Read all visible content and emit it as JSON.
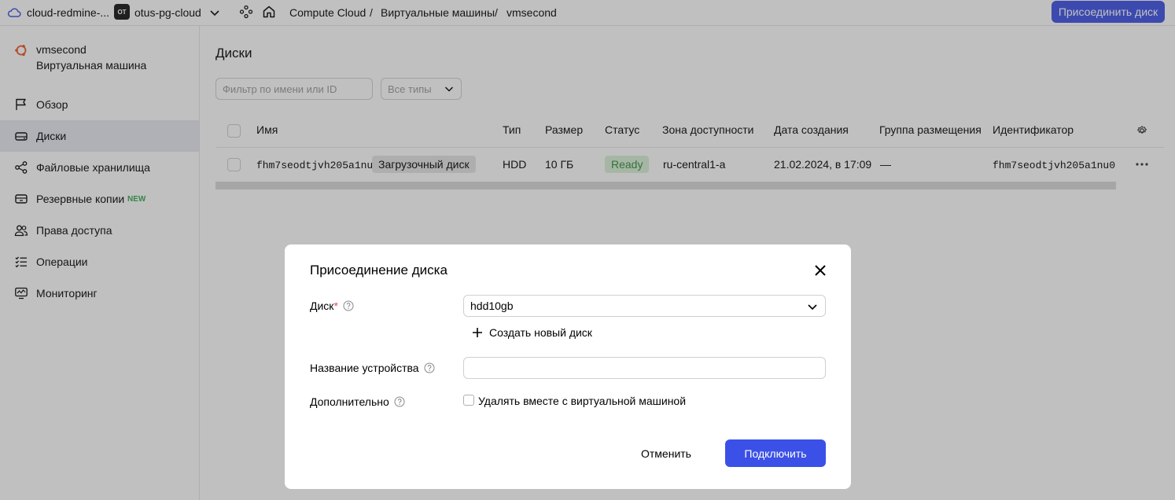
{
  "topbar": {
    "cloud_name": "cloud-redmine-...",
    "folder_badge": "OT",
    "folder_name": "otus-pg-cloud",
    "breadcrumbs": [
      "Compute Cloud",
      "Виртуальные машины",
      "vmsecond"
    ],
    "separator": "/",
    "attach_button": "Присоединить диск"
  },
  "sidebar": {
    "vm_name": "vmsecond",
    "vm_type": "Виртуальная машина",
    "items": [
      {
        "label": "Обзор",
        "icon": "flag-icon"
      },
      {
        "label": "Диски",
        "icon": "disk-icon",
        "active": true
      },
      {
        "label": "Файловые хранилища",
        "icon": "file-storage-icon"
      },
      {
        "label": "Резервные копии",
        "icon": "backup-icon",
        "badge": "NEW"
      },
      {
        "label": "Права доступа",
        "icon": "users-icon"
      },
      {
        "label": "Операции",
        "icon": "operations-icon"
      },
      {
        "label": "Мониторинг",
        "icon": "monitoring-icon"
      }
    ]
  },
  "main": {
    "title": "Диски",
    "filter_placeholder": "Фильтр по имени или ID",
    "type_select": "Все типы",
    "columns": [
      "Имя",
      "Тип",
      "Размер",
      "Статус",
      "Зона доступности",
      "Дата создания",
      "Группа размещения",
      "Идентификатор"
    ],
    "rows": [
      {
        "name": "fhm7seodtjvh205a1nu0",
        "tag": "Загрузочный диск",
        "type": "HDD",
        "size": "10 ГБ",
        "status": "Ready",
        "zone": "ru-central1-a",
        "created": "21.02.2024, в 17:09",
        "placement_group": "—",
        "id": "fhm7seodtjvh205a1nu0"
      }
    ]
  },
  "modal": {
    "title": "Присоединение диска",
    "disk_label": "Диск",
    "required_mark": "*",
    "disk_value": "hdd10gb",
    "create_disk": "Создать новый диск",
    "device_label": "Название устройства",
    "device_value": "",
    "extra_label": "Дополнительно",
    "delete_checkbox_label": "Удалять вместе с виртуальной машиной",
    "delete_checked": false,
    "cancel": "Отменить",
    "connect": "Подключить"
  },
  "colors": {
    "accent": "#3b50e6",
    "status_ready_bg": "#d8f0d6",
    "status_ready_text": "#2e8b3a",
    "new_badge": "#32a852",
    "required": "#ff4040"
  }
}
